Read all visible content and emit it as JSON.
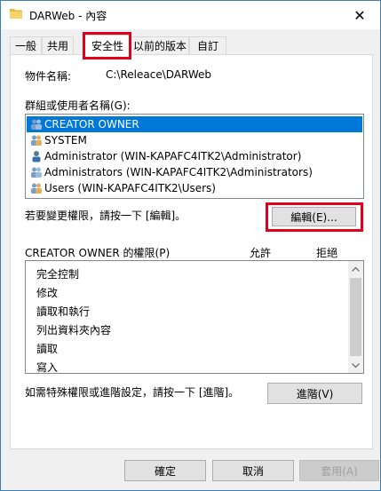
{
  "window": {
    "title": "DARWeb - 內容",
    "close_glyph": "✕"
  },
  "tabs": [
    {
      "label": "一般",
      "active": false
    },
    {
      "label": "共用",
      "active": false
    },
    {
      "label": "安全性",
      "active": true
    },
    {
      "label": "以前的版本",
      "active": false
    },
    {
      "label": "自訂",
      "active": false
    }
  ],
  "security": {
    "object_label": "物件名稱:",
    "object_value": "C:\\Releace\\DARWeb",
    "groups_label": "群組或使用者名稱(G):",
    "groups": [
      {
        "name": "CREATOR OWNER",
        "icon": "group-users-icon",
        "selected": true
      },
      {
        "name": "SYSTEM",
        "icon": "group-users-icon",
        "selected": false
      },
      {
        "name": "Administrator (WIN-KAPAFC4ITK2\\Administrator)",
        "icon": "single-user-icon",
        "selected": false
      },
      {
        "name": "Administrators (WIN-KAPAFC4ITK2\\Administrators)",
        "icon": "group-users-icon",
        "selected": false
      },
      {
        "name": "Users (WIN-KAPAFC4ITK2\\Users)",
        "icon": "group-users-icon",
        "selected": false
      }
    ],
    "edit_hint": "若要變更權限，請按一下 [編輯]。",
    "edit_button": "編輯(E)...",
    "perm_header": "CREATOR OWNER 的權限(P)",
    "allow_header": "允許",
    "deny_header": "拒絕",
    "permissions": [
      "完全控制",
      "修改",
      "讀取和執行",
      "列出資料夾內容",
      "讀取",
      "寫入"
    ],
    "advanced_hint": "如需特殊權限或進階設定，請按一下 [進階]。",
    "advanced_button": "進階(V)"
  },
  "footer": {
    "ok": "確定",
    "cancel": "取消",
    "apply": "套用(A)"
  },
  "colors": {
    "selection": "#0078d7",
    "highlight_box": "#e0001b"
  }
}
